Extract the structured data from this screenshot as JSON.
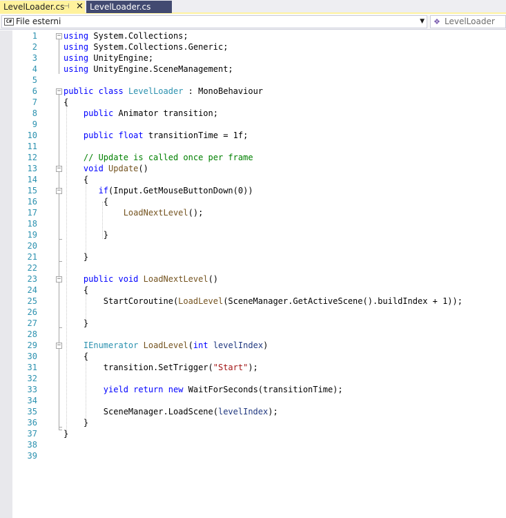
{
  "tabs": [
    {
      "label": "LevelLoader.cs",
      "active": true,
      "pin_icon": "pin-icon",
      "close_icon": "close-icon"
    },
    {
      "label": "LevelLoader.cs",
      "active": false
    }
  ],
  "navbar": {
    "project_label": "File esterni",
    "project_icon": "csharp-file-icon",
    "class_label": "LevelLoader",
    "class_icon": "class-icon"
  },
  "colors": {
    "keyword": "#0000ff",
    "type": "#2b91af",
    "comment": "#008000",
    "string": "#a31515",
    "method": "#74531f",
    "parameter": "#1f377f",
    "active_tab": "#fff29d",
    "inactive_tab": "#424a71",
    "line_number": "#2b91af"
  },
  "editor": {
    "lines": [
      {
        "n": "1",
        "tokens": [
          [
            "kw",
            "using"
          ],
          [
            "pl",
            " System.Collections;"
          ]
        ]
      },
      {
        "n": "2",
        "tokens": [
          [
            "kw",
            "using"
          ],
          [
            "pl",
            " System.Collections.Generic;"
          ]
        ]
      },
      {
        "n": "3",
        "tokens": [
          [
            "kw",
            "using"
          ],
          [
            "pl",
            " UnityEngine;"
          ]
        ]
      },
      {
        "n": "4",
        "tokens": [
          [
            "kw",
            "using"
          ],
          [
            "pl",
            " UnityEngine.SceneManagement;"
          ]
        ]
      },
      {
        "n": "5",
        "tokens": []
      },
      {
        "n": "6",
        "tokens": [
          [
            "kw",
            "public"
          ],
          [
            "pl",
            " "
          ],
          [
            "kw",
            "class"
          ],
          [
            "pl",
            " "
          ],
          [
            "ty",
            "LevelLoader"
          ],
          [
            "pl",
            " : MonoBehaviour"
          ]
        ]
      },
      {
        "n": "7",
        "tokens": [
          [
            "pl",
            "{"
          ]
        ]
      },
      {
        "n": "8",
        "tokens": [
          [
            "pl",
            "    "
          ],
          [
            "kw",
            "public"
          ],
          [
            "pl",
            " Animator transition;"
          ]
        ]
      },
      {
        "n": "9",
        "tokens": []
      },
      {
        "n": "10",
        "tokens": [
          [
            "pl",
            "    "
          ],
          [
            "kw",
            "public"
          ],
          [
            "pl",
            " "
          ],
          [
            "kw",
            "float"
          ],
          [
            "pl",
            " transitionTime = 1f;"
          ]
        ]
      },
      {
        "n": "11",
        "tokens": []
      },
      {
        "n": "12",
        "tokens": [
          [
            "pl",
            "    "
          ],
          [
            "cm",
            "// Update is called once per frame"
          ]
        ]
      },
      {
        "n": "13",
        "tokens": [
          [
            "pl",
            "    "
          ],
          [
            "kw",
            "void"
          ],
          [
            "pl",
            " "
          ],
          [
            "mt",
            "Update"
          ],
          [
            "pl",
            "()"
          ]
        ]
      },
      {
        "n": "14",
        "tokens": [
          [
            "pl",
            "    {"
          ]
        ]
      },
      {
        "n": "15",
        "tokens": [
          [
            "pl",
            "       "
          ],
          [
            "kw",
            "if"
          ],
          [
            "pl",
            "(Input.GetMouseButtonDown(0))"
          ]
        ]
      },
      {
        "n": "16",
        "tokens": [
          [
            "pl",
            "        {"
          ]
        ]
      },
      {
        "n": "17",
        "tokens": [
          [
            "pl",
            "            "
          ],
          [
            "mt",
            "LoadNextLevel"
          ],
          [
            "pl",
            "();"
          ]
        ]
      },
      {
        "n": "18",
        "tokens": []
      },
      {
        "n": "19",
        "tokens": [
          [
            "pl",
            "        }"
          ]
        ]
      },
      {
        "n": "20",
        "tokens": []
      },
      {
        "n": "21",
        "tokens": [
          [
            "pl",
            "    }"
          ]
        ]
      },
      {
        "n": "22",
        "tokens": []
      },
      {
        "n": "23",
        "tokens": [
          [
            "pl",
            "    "
          ],
          [
            "kw",
            "public"
          ],
          [
            "pl",
            " "
          ],
          [
            "kw",
            "void"
          ],
          [
            "pl",
            " "
          ],
          [
            "mt",
            "LoadNextLevel"
          ],
          [
            "pl",
            "()"
          ]
        ]
      },
      {
        "n": "24",
        "tokens": [
          [
            "pl",
            "    {"
          ]
        ]
      },
      {
        "n": "25",
        "tokens": [
          [
            "pl",
            "        StartCoroutine("
          ],
          [
            "mt",
            "LoadLevel"
          ],
          [
            "pl",
            "(SceneManager.GetActiveScene().buildIndex + 1));"
          ]
        ]
      },
      {
        "n": "26",
        "tokens": []
      },
      {
        "n": "27",
        "tokens": [
          [
            "pl",
            "    }"
          ]
        ]
      },
      {
        "n": "28",
        "tokens": []
      },
      {
        "n": "29",
        "tokens": [
          [
            "pl",
            "    "
          ],
          [
            "ty",
            "IEnumerator"
          ],
          [
            "pl",
            " "
          ],
          [
            "mt",
            "LoadLevel"
          ],
          [
            "pl",
            "("
          ],
          [
            "kw",
            "int"
          ],
          [
            "pl",
            " "
          ],
          [
            "pm",
            "levelIndex"
          ],
          [
            "pl",
            ")"
          ]
        ]
      },
      {
        "n": "30",
        "tokens": [
          [
            "pl",
            "    {"
          ]
        ]
      },
      {
        "n": "31",
        "tokens": [
          [
            "pl",
            "        transition.SetTrigger("
          ],
          [
            "st",
            "\"Start\""
          ],
          [
            "pl",
            ");"
          ]
        ]
      },
      {
        "n": "32",
        "tokens": []
      },
      {
        "n": "33",
        "tokens": [
          [
            "pl",
            "        "
          ],
          [
            "kw",
            "yield"
          ],
          [
            "pl",
            " "
          ],
          [
            "kw",
            "return"
          ],
          [
            "pl",
            " "
          ],
          [
            "kw",
            "new"
          ],
          [
            "pl",
            " WaitForSeconds(transitionTime);"
          ]
        ]
      },
      {
        "n": "34",
        "tokens": []
      },
      {
        "n": "35",
        "tokens": [
          [
            "pl",
            "        SceneManager.LoadScene("
          ],
          [
            "pm",
            "levelIndex"
          ],
          [
            "pl",
            ");"
          ]
        ]
      },
      {
        "n": "36",
        "tokens": [
          [
            "pl",
            "    }"
          ]
        ]
      },
      {
        "n": "37",
        "tokens": [
          [
            "pl",
            "}"
          ]
        ]
      },
      {
        "n": "38",
        "tokens": []
      },
      {
        "n": "39",
        "tokens": []
      }
    ]
  }
}
